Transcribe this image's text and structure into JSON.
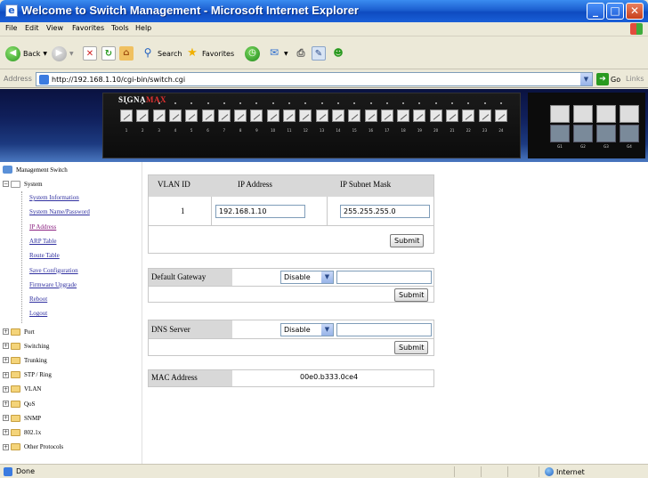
{
  "window": {
    "title": "Welcome to Switch Management - Microsoft Internet Explorer",
    "buttons": {
      "minimize": "_",
      "maximize": "□",
      "close": "✕"
    }
  },
  "menu": [
    "File",
    "Edit",
    "View",
    "Favorites",
    "Tools",
    "Help"
  ],
  "toolbar": {
    "back": "Back",
    "search": "Search",
    "favorites": "Favorites"
  },
  "address": {
    "label": "Address",
    "url": "http://192.168.1.10/cgi-bin/switch.cgi",
    "go": "Go",
    "links": "Links"
  },
  "banner": {
    "brand_a": "SIGNA",
    "brand_b": "MAX",
    "ports": [
      "1",
      "2",
      "3",
      "4",
      "5",
      "6",
      "7",
      "8",
      "9",
      "10",
      "11",
      "12",
      "13",
      "14",
      "15",
      "16",
      "17",
      "18",
      "19",
      "20",
      "21",
      "22",
      "23",
      "24"
    ],
    "uplinks": [
      "G1",
      "G2",
      "G3",
      "G4"
    ]
  },
  "nav": {
    "root": "Management Switch",
    "system": "System",
    "system_links": [
      {
        "label": "System Information",
        "visited": false
      },
      {
        "label": "System Name/Password",
        "visited": false
      },
      {
        "label": "IP Address",
        "visited": true
      },
      {
        "label": "ARP Table",
        "visited": false
      },
      {
        "label": "Route Table",
        "visited": false
      },
      {
        "label": "Save Configuration",
        "visited": false
      },
      {
        "label": "Firmware Upgrade",
        "visited": false
      },
      {
        "label": "Reboot",
        "visited": false
      },
      {
        "label": "Logout",
        "visited": false
      }
    ],
    "folders": [
      "Port",
      "Switching",
      "Trunking",
      "STP / Ring",
      "VLAN",
      "QoS",
      "SNMP",
      "802.1x",
      "Other Protocols"
    ]
  },
  "ip_table": {
    "headers": {
      "vlan": "VLAN ID",
      "ip": "IP Address",
      "mask": "IP Subnet Mask"
    },
    "row": {
      "vlan": "1",
      "ip": "192.168.1.10",
      "mask": "255.255.255.0"
    },
    "submit": "Submit"
  },
  "gateway": {
    "label": "Default Gateway",
    "mode": "Disable",
    "value": "",
    "submit": "Submit"
  },
  "dns": {
    "label": "DNS Server",
    "mode": "Disable",
    "value": "",
    "submit": "Submit"
  },
  "mac": {
    "label": "MAC Address",
    "value": "00e0.b333.0ce4"
  },
  "status": {
    "text": "Done",
    "zone": "Internet"
  }
}
